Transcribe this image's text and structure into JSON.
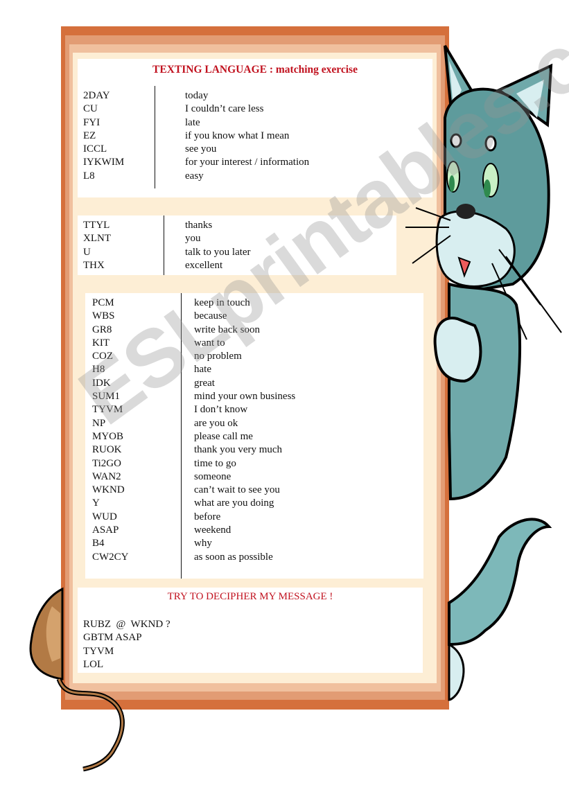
{
  "worksheet": {
    "title": "TEXTING LANGUAGE : matching exercise",
    "watermark": "ESLprintables.com",
    "accent_color": "#c1121f",
    "frame_colors": [
      "#d5703c",
      "#e29c74",
      "#f0c09e",
      "#fdeed5"
    ],
    "section1": {
      "abbreviations": [
        "2DAY",
        "CU",
        "FYI",
        "EZ",
        "ICCL",
        "IYKWIM",
        "L8"
      ],
      "meanings": [
        "today",
        "I couldn’t care less",
        "late",
        "if you know what I mean",
        "see you",
        "for your interest / information",
        "easy"
      ]
    },
    "section2": {
      "abbreviations": [
        "TTYL",
        "XLNT",
        "U",
        "THX"
      ],
      "meanings": [
        "thanks",
        "you",
        "talk to you later",
        "excellent"
      ]
    },
    "section3": {
      "abbreviations": [
        "PCM",
        "WBS",
        "GR8",
        "KIT",
        "COZ",
        "H8",
        "IDK",
        "SUM1",
        "TYVM",
        "NP",
        "MYOB",
        "RUOK",
        "Ti2GO",
        "WAN2",
        "WKND",
        "Y",
        "WUD",
        "ASAP",
        "B4",
        "CW2CY"
      ],
      "meanings": [
        "keep in touch",
        "because",
        "write back soon",
        "want to",
        "no problem",
        "hate",
        "great",
        "mind your own business",
        "I don’t know",
        "are you ok",
        "please call me",
        "thank you very much",
        "time to go",
        "someone",
        "can’t wait to see you",
        "what are you doing",
        "before",
        "weekend",
        "why",
        "as soon as possible"
      ]
    },
    "message": {
      "title": "TRY TO DECIPHER MY MESSAGE !",
      "lines": [
        "RUBZ  @  WKND ?",
        "GBTM ASAP",
        "TYVM",
        "LOL"
      ]
    },
    "illustrations": {
      "cat": "cartoon-cat-peeking",
      "mouse": "cartoon-mouse-tail"
    }
  }
}
